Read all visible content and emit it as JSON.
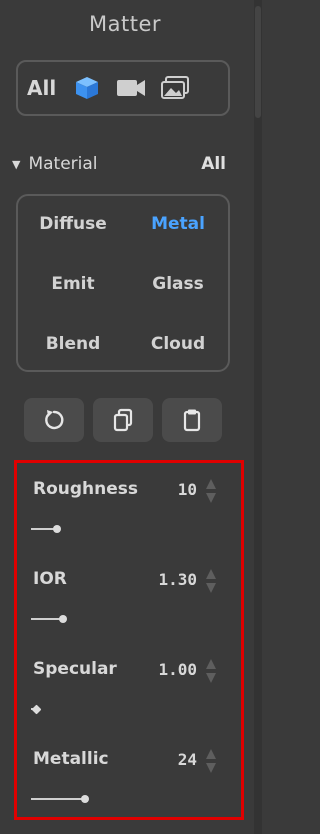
{
  "panel": {
    "title": "Matter"
  },
  "filter": {
    "all_label": "All",
    "icons": [
      "cube-icon",
      "video-camera-icon",
      "images-icon"
    ],
    "active_color": "#4aa3ff"
  },
  "material_section": {
    "label": "Material",
    "scope": "All",
    "types": [
      {
        "label": "Diffuse",
        "active": false
      },
      {
        "label": "Metal",
        "active": true
      },
      {
        "label": "Emit",
        "active": false
      },
      {
        "label": "Glass",
        "active": false
      },
      {
        "label": "Blend",
        "active": false
      },
      {
        "label": "Cloud",
        "active": false
      }
    ]
  },
  "tools": [
    "reset-icon",
    "copy-icon",
    "paste-icon"
  ],
  "parameters": [
    {
      "name": "Roughness",
      "value": "10",
      "fraction": 0.1
    },
    {
      "name": "IOR",
      "value": "1.30",
      "fraction": 0.13
    },
    {
      "name": "Specular",
      "value": "1.00",
      "fraction": 0.0
    },
    {
      "name": "Metallic",
      "value": "24",
      "fraction": 0.24
    }
  ],
  "highlight_color": "#e00000"
}
